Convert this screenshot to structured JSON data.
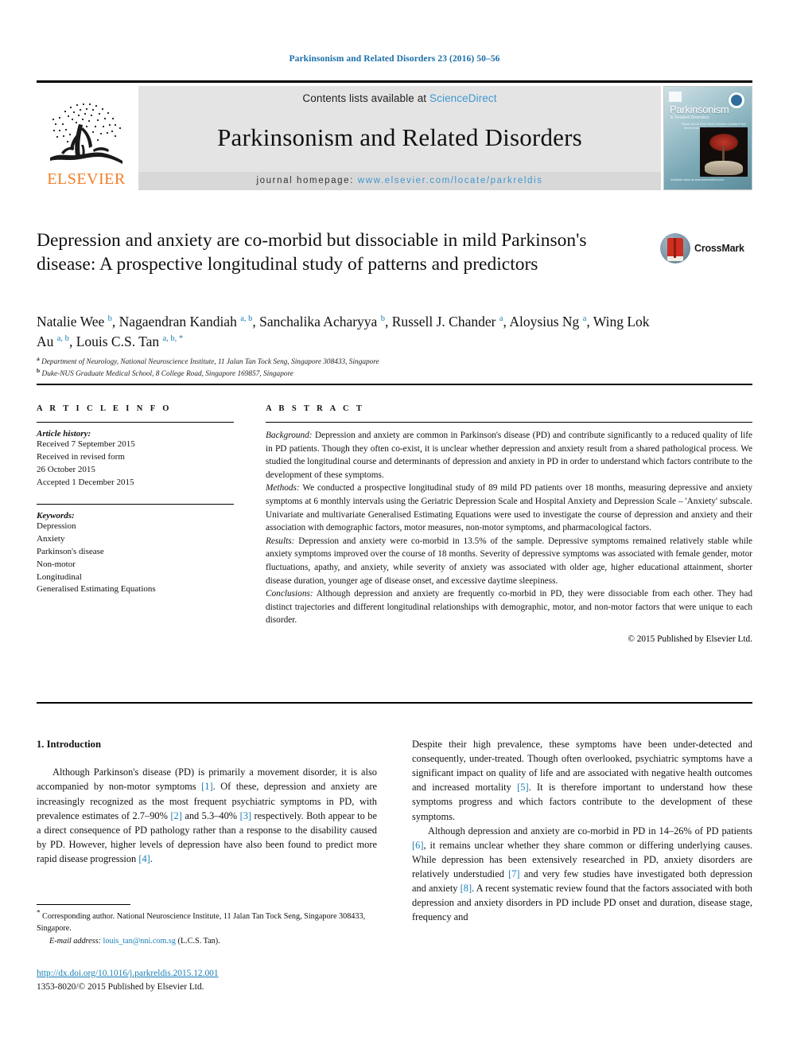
{
  "running_head": "Parkinsonism and Related Disorders 23 (2016) 50–56",
  "masthead": {
    "contents_prefix": "Contents lists available at ",
    "sciencedirect": "ScienceDirect",
    "journal_name": "Parkinsonism and Related Disorders",
    "homepage_label": "journal homepage: ",
    "homepage_url": "www.elsevier.com/locate/parkreldis",
    "publisher_wordmark": "ELSEVIER",
    "cover": {
      "title": "Parkinsonism",
      "subtitle": "& Related Disorders",
      "editors": "Official Journal of the World Parkinson Coalition® and the International Association of Parkinsonism and Related Disorders",
      "footer": "Available online at\nwww.sciencedirect.com"
    }
  },
  "article": {
    "title": "Depression and anxiety are co-morbid but dissociable in mild Parkinson's disease: A prospective longitudinal study of patterns and predictors",
    "crossmark_label": "CrossMark",
    "authors": [
      {
        "name": "Natalie Wee",
        "marks": "b"
      },
      {
        "name": "Nagaendran Kandiah",
        "marks": "a, b"
      },
      {
        "name": "Sanchalika Acharyya",
        "marks": "b"
      },
      {
        "name": "Russell J. Chander",
        "marks": "a"
      },
      {
        "name": "Aloysius Ng",
        "marks": "a"
      },
      {
        "name": "Wing Lok Au",
        "marks": "a, b"
      },
      {
        "name": "Louis C.S. Tan",
        "marks": "a, b, *"
      }
    ],
    "affiliations": [
      {
        "mark": "a",
        "text": "Department of Neurology, National Neuroscience Institute, 11 Jalan Tan Tock Seng, Singapore 308433, Singapore"
      },
      {
        "mark": "b",
        "text": "Duke-NUS Graduate Medical School, 8 College Road, Singapore 169857, Singapore"
      }
    ]
  },
  "article_info": {
    "label": "A R T I C L E  I N F O",
    "history_head": "Article history:",
    "history": [
      "Received 7 September 2015",
      "Received in revised form",
      "26 October 2015",
      "Accepted 1 December 2015"
    ],
    "keywords_head": "Keywords:",
    "keywords": [
      "Depression",
      "Anxiety",
      "Parkinson's disease",
      "Non-motor",
      "Longitudinal",
      "Generalised Estimating Equations"
    ]
  },
  "abstract": {
    "label": "A B S T R A C T",
    "sections": [
      {
        "lead": "Background:",
        "text": " Depression and anxiety are common in Parkinson's disease (PD) and contribute significantly to a reduced quality of life in PD patients. Though they often co-exist, it is unclear whether depression and anxiety result from a shared pathological process. We studied the longitudinal course and determinants of depression and anxiety in PD in order to understand which factors contribute to the development of these symptoms."
      },
      {
        "lead": "Methods:",
        "text": " We conducted a prospective longitudinal study of 89 mild PD patients over 18 months, measuring depressive and anxiety symptoms at 6 monthly intervals using the Geriatric Depression Scale and Hospital Anxiety and Depression Scale – 'Anxiety' subscale. Univariate and multivariate Generalised Estimating Equations were used to investigate the course of depression and anxiety and their association with demographic factors, motor measures, non-motor symptoms, and pharmacological factors."
      },
      {
        "lead": "Results:",
        "text": " Depression and anxiety were co-morbid in 13.5% of the sample. Depressive symptoms remained relatively stable while anxiety symptoms improved over the course of 18 months. Severity of depressive symptoms was associated with female gender, motor fluctuations, apathy, and anxiety, while severity of anxiety was associated with older age, higher educational attainment, shorter disease duration, younger age of disease onset, and excessive daytime sleepiness."
      },
      {
        "lead": "Conclusions:",
        "text": " Although depression and anxiety are frequently co-morbid in PD, they were dissociable from each other. They had distinct trajectories and different longitudinal relationships with demographic, motor, and non-motor factors that were unique to each disorder."
      }
    ],
    "copyright": "© 2015 Published by Elsevier Ltd."
  },
  "body": {
    "section_heading": "1. Introduction",
    "left_paragraphs": [
      "Although Parkinson's disease (PD) is primarily a movement disorder, it is also accompanied by non-motor symptoms [1]. Of these, depression and anxiety are increasingly recognized as the most frequent psychiatric symptoms in PD, with prevalence estimates of 2.7–90% [2] and 5.3–40% [3] respectively. Both appear to be a direct consequence of PD pathology rather than a response to the disability caused by PD. However, higher levels of depression have also been found to predict more rapid disease progression [4]."
    ],
    "right_paragraphs": [
      "Despite their high prevalence, these symptoms have been under-detected and consequently, under-treated. Though often overlooked, psychiatric symptoms have a significant impact on quality of life and are associated with negative health outcomes and increased mortality [5]. It is therefore important to understand how these symptoms progress and which factors contribute to the development of these symptoms.",
      "Although depression and anxiety are co-morbid in PD in 14–26% of PD patients [6], it remains unclear whether they share common or differing underlying causes. While depression has been extensively researched in PD, anxiety disorders are relatively understudied [7] and very few studies have investigated both depression and anxiety [8]. A recent systematic review found that the factors associated with both depression and anxiety disorders in PD include PD onset and duration, disease stage, frequency and"
    ]
  },
  "footnotes": {
    "corresponding": "Corresponding author. National Neuroscience Institute, 11 Jalan Tan Tock Seng, Singapore 308433, Singapore.",
    "email_label": "E-mail address:",
    "email": "louis_tan@nni.com.sg",
    "email_owner": "(L.C.S. Tan).",
    "doi": "http://dx.doi.org/10.1016/j.parkreldis.2015.12.001",
    "issn_line": "1353-8020/© 2015 Published by Elsevier Ltd."
  },
  "colors": {
    "link": "#1a7fb5",
    "elsevier_orange": "#f07e26",
    "sciencedirect": "#3f97cf",
    "crossmark_red": "#cf2e20"
  }
}
